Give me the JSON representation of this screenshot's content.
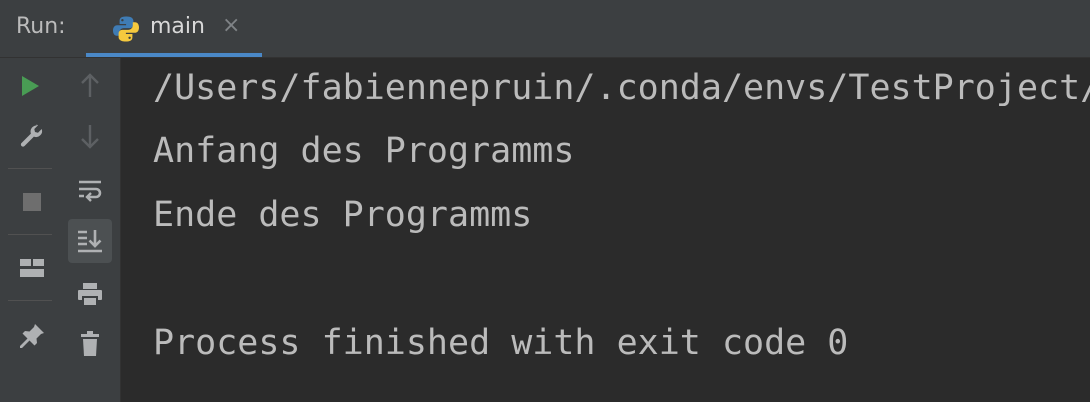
{
  "run_panel": {
    "label": "Run:",
    "tab": {
      "label": "main",
      "icon": "python-icon",
      "close_icon": "close-icon"
    }
  },
  "toolbar": {
    "left": [
      {
        "name": "rerun-icon",
        "color": "#499c54"
      },
      {
        "name": "wrench-icon"
      },
      {
        "name": "stop-icon"
      },
      {
        "name": "layout-icon"
      },
      {
        "name": "pin-icon"
      }
    ],
    "right": [
      {
        "name": "arrow-up-icon"
      },
      {
        "name": "arrow-down-icon"
      },
      {
        "name": "soft-wrap-icon"
      },
      {
        "name": "scroll-to-end-icon",
        "active": true
      },
      {
        "name": "print-icon"
      },
      {
        "name": "trash-icon"
      }
    ]
  },
  "console": {
    "lines": [
      "/Users/fabiennepruin/.conda/envs/TestProject/bin/python",
      "Anfang des Programms",
      "Ende des Programms",
      "",
      "Process finished with exit code 0"
    ]
  },
  "colors": {
    "background": "#2b2b2b",
    "panel": "#3c3f41",
    "text": "#bbbbbb",
    "accent": "#4a88c7",
    "run_green": "#499c54"
  }
}
